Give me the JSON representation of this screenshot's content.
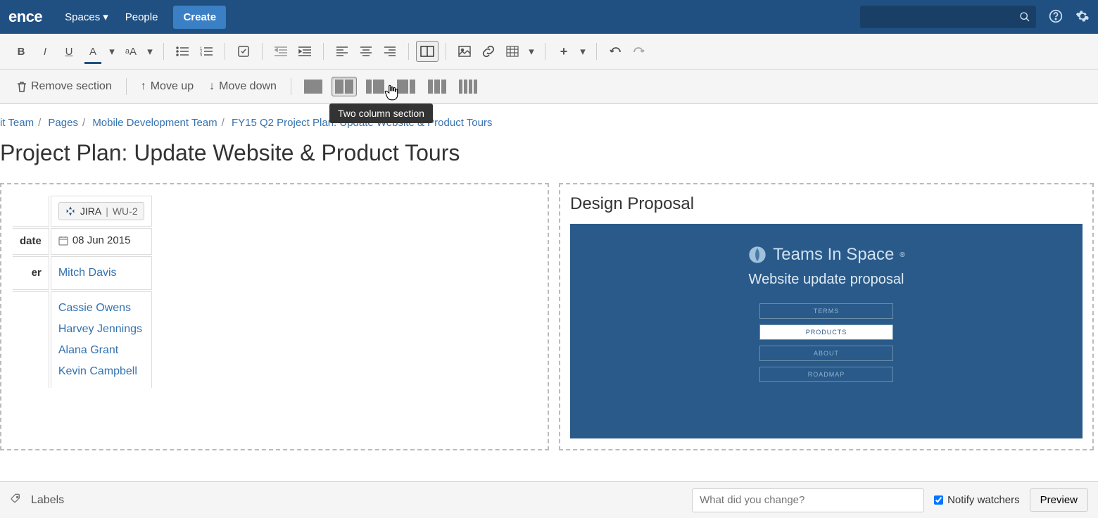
{
  "nav": {
    "logo_fragment": "ence",
    "spaces": "Spaces",
    "people": "People",
    "create": "Create"
  },
  "toolbar": {
    "remove_section": "Remove section",
    "move_up": "Move up",
    "move_down": "Move down",
    "tooltip": "Two column section"
  },
  "breadcrumb": {
    "items": [
      "it Team",
      "Pages",
      "Mobile Development Team",
      "FY15 Q2 Project Plan: Update Website & Product Tours"
    ]
  },
  "page": {
    "title": "Project Plan: Update Website & Product Tours"
  },
  "meta": {
    "jira_label": "JIRA",
    "jira_key": "WU-2",
    "date_label": "date",
    "date_value": "08 Jun 2015",
    "owner_label": "er",
    "users": [
      "Mitch Davis",
      "Cassie Owens",
      "Harvey Jennings",
      "Alana Grant",
      "Kevin Campbell"
    ]
  },
  "right": {
    "heading": "Design Proposal",
    "mock_brand": "Teams In Space",
    "mock_sub": "Website update proposal",
    "mock_buttons": [
      "TERMS",
      "PRODUCTS",
      "ABOUT",
      "ROADMAP"
    ]
  },
  "footer": {
    "labels": "Labels",
    "change_placeholder": "What did you change?",
    "notify": "Notify watchers",
    "preview": "Preview"
  }
}
